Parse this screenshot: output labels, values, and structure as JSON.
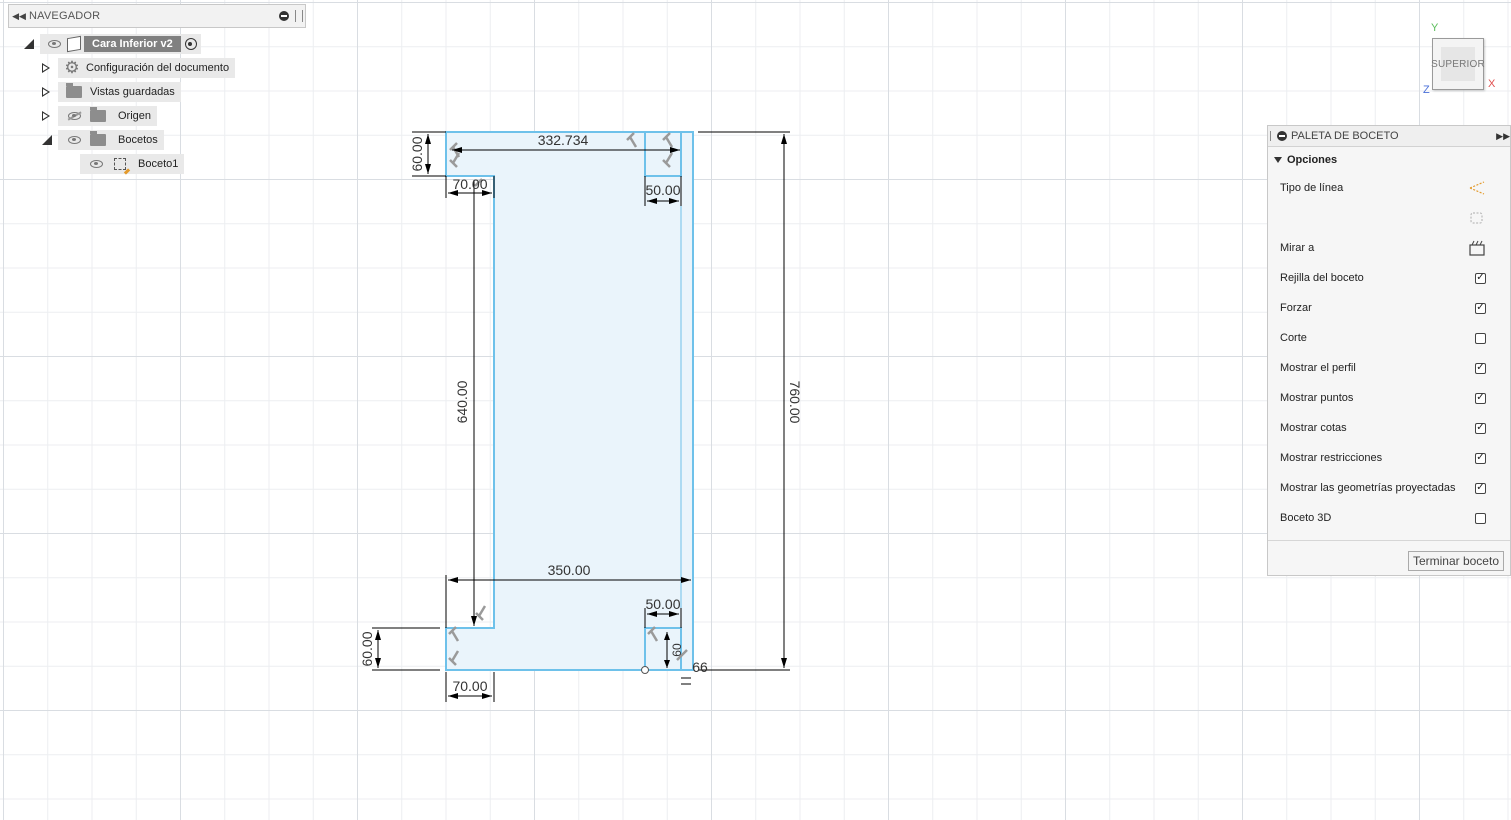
{
  "navigator": {
    "title": "NAVEGADOR",
    "root": "Cara Inferior v2",
    "items": [
      {
        "label": "Configuración del documento",
        "icon": "gear-icon"
      },
      {
        "label": "Vistas guardadas",
        "icon": "folder-icon"
      },
      {
        "label": "Origen",
        "icon": "folder-icon"
      },
      {
        "label": "Bocetos",
        "icon": "folder-icon"
      },
      {
        "label": "Boceto1",
        "icon": "sketch-icon"
      }
    ]
  },
  "viewcube": {
    "face": "SUPERIOR",
    "axis_y": "Y",
    "axis_x": "X",
    "axis_z": "Z"
  },
  "dimensions": {
    "top_width": "332.734",
    "top_left_height": "60.00",
    "top_left_width": "70.00",
    "top_right_width": "50.00",
    "left_height": "640.00",
    "total_height": "760.00",
    "bottom_width": "350.00",
    "bottom_right_width": "50.00",
    "bottom_left_height": "60.00",
    "bottom_left_width": "70.00",
    "bottom_small_a": "60",
    "bottom_small_b": "66"
  },
  "palette": {
    "title": "PALETA DE BOCETO",
    "section": "Opciones",
    "line_type_label": "Tipo de línea",
    "look_at_label": "Mirar a",
    "options": [
      {
        "label": "Rejilla del boceto",
        "checked": true
      },
      {
        "label": "Forzar",
        "checked": true
      },
      {
        "label": "Corte",
        "checked": false
      },
      {
        "label": "Mostrar el perfil",
        "checked": true
      },
      {
        "label": "Mostrar puntos",
        "checked": true
      },
      {
        "label": "Mostrar cotas",
        "checked": true
      },
      {
        "label": "Mostrar restricciones",
        "checked": true
      },
      {
        "label": "Mostrar las geometrías proyectadas",
        "checked": true
      },
      {
        "label": "Boceto 3D",
        "checked": false
      }
    ],
    "finish_button": "Terminar boceto"
  },
  "colors": {
    "profile_fill": "#eaf4fb",
    "sketch_line": "#6ec1ea",
    "dimension": "#000000",
    "axis_x": "#e0504f",
    "axis_y": "#5bbd5b",
    "axis_z": "#4a6fd8"
  }
}
